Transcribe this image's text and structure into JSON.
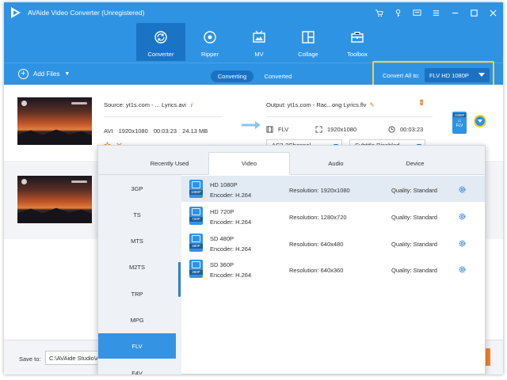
{
  "app": {
    "title": "AVAide Video Converter (Unregistered)",
    "accent_color": "#2f93e3"
  },
  "window_controls": [
    "cart-icon",
    "key-icon",
    "chat-icon",
    "menu-icon",
    "minimize-icon",
    "maximize-icon",
    "close-icon"
  ],
  "nav": {
    "tabs": [
      {
        "label": "Converter",
        "icon": "converter-icon",
        "active": true
      },
      {
        "label": "Ripper",
        "icon": "ripper-icon",
        "active": false
      },
      {
        "label": "MV",
        "icon": "mv-icon",
        "active": false
      },
      {
        "label": "Collage",
        "icon": "collage-icon",
        "active": false
      },
      {
        "label": "Toolbox",
        "icon": "toolbox-icon",
        "active": false
      }
    ]
  },
  "toolbar": {
    "add_files": "Add Files",
    "seg_converting": "Converting",
    "seg_converted": "Converted",
    "convert_all_label": "Convert All to:",
    "convert_all_value": "FLV HD 1080P"
  },
  "file": {
    "source": "Source: yt1s.com - ... Lyrics.avi",
    "info_icon": "i",
    "format": "AVI",
    "resolution": "1920x1080",
    "duration": "00:03:23",
    "size": "24.13 MB",
    "output": "Output: yt1s.com - Rac...ong Lyrics.flv",
    "out_format": "FLV",
    "out_resolution": "1920x1080",
    "out_duration": "00:03:23",
    "audio_track": "AC3-2Channel",
    "subtitle": "Subtitle Disabled",
    "badge_tag": "1080P",
    "badge_format": "FLV"
  },
  "bottom": {
    "save_to_label": "Save to:",
    "save_path": "C:\\AVAide Studio\\AVA"
  },
  "format_panel": {
    "tabs": [
      "Recently Used",
      "Video",
      "Audio",
      "Device"
    ],
    "active_tab": "Video",
    "formats": [
      "3GP",
      "TS",
      "MTS",
      "M2TS",
      "TRP",
      "MPG",
      "FLV",
      "F4V"
    ],
    "active_format": "FLV",
    "presets": [
      {
        "name": "HD 1080P",
        "tag": "1080P",
        "encoder": "Encoder: H.264",
        "resolution": "Resolution: 1920x1080",
        "quality": "Quality: Standard"
      },
      {
        "name": "HD 720P",
        "tag": "720P",
        "encoder": "Encoder: H.264",
        "resolution": "Resolution: 1280x720",
        "quality": "Quality: Standard"
      },
      {
        "name": "SD 480P",
        "tag": "480P",
        "encoder": "Encoder: H.264",
        "resolution": "Resolution: 640x480",
        "quality": "Quality: Standard"
      },
      {
        "name": "SD 360P",
        "tag": "360P",
        "encoder": "Encoder: H.264",
        "resolution": "Resolution: 640x360",
        "quality": "Quality: Standard"
      }
    ]
  }
}
